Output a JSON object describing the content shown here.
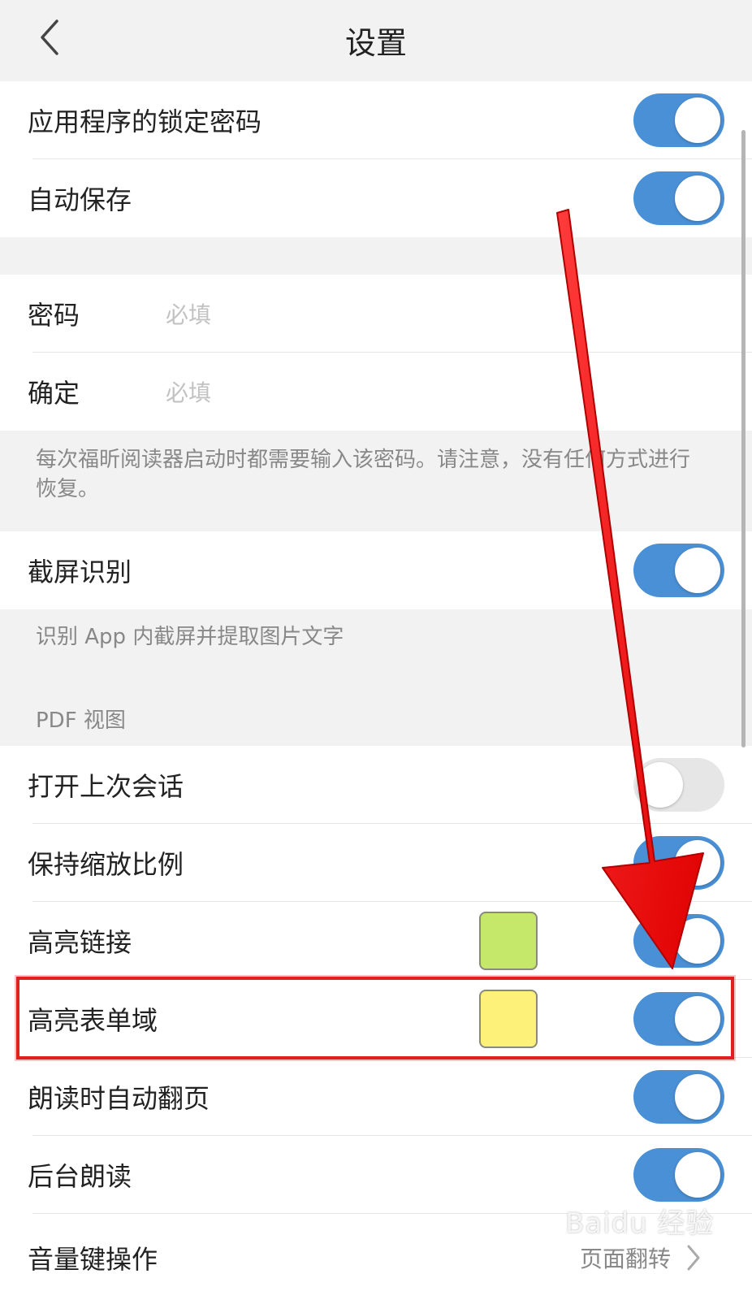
{
  "header": {
    "title": "设置"
  },
  "security": {
    "app_lock_label": "应用程序的锁定密码",
    "auto_save_label": "自动保存"
  },
  "password": {
    "password_label": "密码",
    "password_placeholder": "必填",
    "confirm_label": "确定",
    "confirm_placeholder": "必填",
    "hint": "每次福昕阅读器启动时都需要输入该密码。请注意，没有任何方式进行恢复。"
  },
  "screenshot": {
    "label": "截屏识别",
    "hint": "识别 App 内截屏并提取图片文字"
  },
  "pdf_view": {
    "section_title": "PDF 视图",
    "items": [
      {
        "label": "打开上次会话",
        "state": "off"
      },
      {
        "label": "保持缩放比例",
        "state": "on"
      },
      {
        "label": "高亮链接",
        "state": "on",
        "swatch_color": "#c5e86a"
      },
      {
        "label": "高亮表单域",
        "state": "on",
        "swatch_color": "#fdf17a"
      },
      {
        "label": "朗读时自动翻页",
        "state": "on"
      },
      {
        "label": "后台朗读",
        "state": "on"
      }
    ],
    "volume_key": {
      "label": "音量键操作",
      "value": "页面翻转"
    }
  },
  "toggles": {
    "app_lock": "on",
    "auto_save": "on",
    "screenshot": "on"
  },
  "colors": {
    "toggle_on": "#4a90d6",
    "toggle_off": "#e6e6e6",
    "annotation_red": "#e02020"
  },
  "icons": {
    "back": "chevron-left-icon",
    "nav": "chevron-right-icon"
  },
  "watermark": {
    "text": "Baidu 经验"
  }
}
